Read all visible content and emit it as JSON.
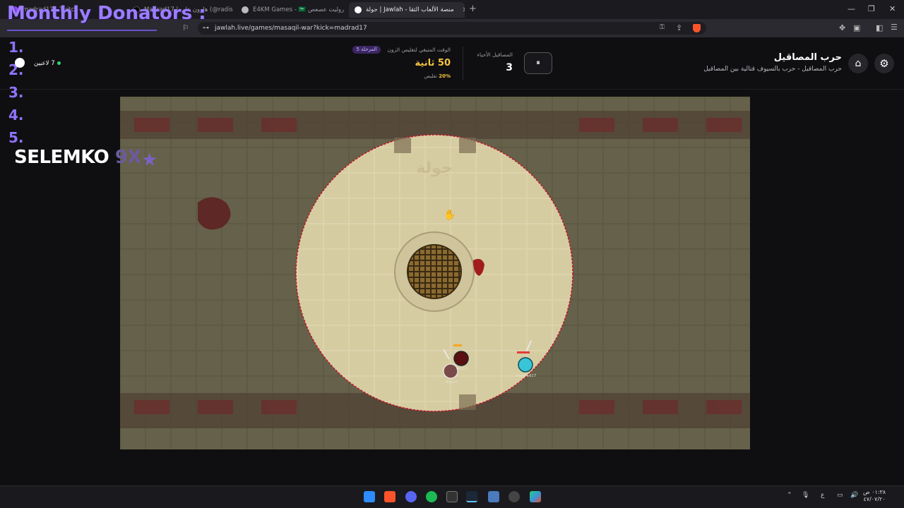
{
  "browser": {
    "tabs": [
      {
        "label": "madrad17 - Twitch",
        "active": false
      },
      {
        "label": "Madrad17 | هارون علي (@radismad17",
        "active": false
      },
      {
        "label": "E4KM Games - 🇸🇦 روليت عصعص",
        "active": false
      },
      {
        "label": "جولة | Jawlah - منصة الألعاب الثقا",
        "active": true
      }
    ],
    "new_tab": "+",
    "url": "jawlah.live/games/masaqil-war?kick=madrad17"
  },
  "overlay": {
    "title": "Monthly Donators :",
    "ranks": [
      "1.",
      "2.",
      "3.",
      "4.",
      "5."
    ],
    "top_name": "SELEMKO",
    "top_mult": "9X"
  },
  "game": {
    "title": "حرب المصاقيل",
    "subtitle": "حرب المصاقيل - حرب بالسيوف قتالية بين المصاقيل",
    "alive_label": "المصاقيل الأحياء",
    "alive_count": "3",
    "time_label": "الوقت المتبقي لتقليص الزون",
    "stage": "المرحلة 5",
    "time_value": "50 ثانية",
    "shrink_percent": "20%",
    "shrink_label": "تقليص",
    "players_count": "7 لاعبين",
    "pause_icon": "⏸",
    "player_tags": [
      "00:57",
      "ifouz7",
      "madrad17"
    ]
  },
  "taskbar": {
    "clock_time": "٠١:٣٨ ص",
    "clock_date": "٤٧/٠٧/٢٠",
    "lang": "ع"
  },
  "colors": {
    "accent": "#9b7dff",
    "zone_border": "#c0142a",
    "gold": "#f5c542"
  }
}
